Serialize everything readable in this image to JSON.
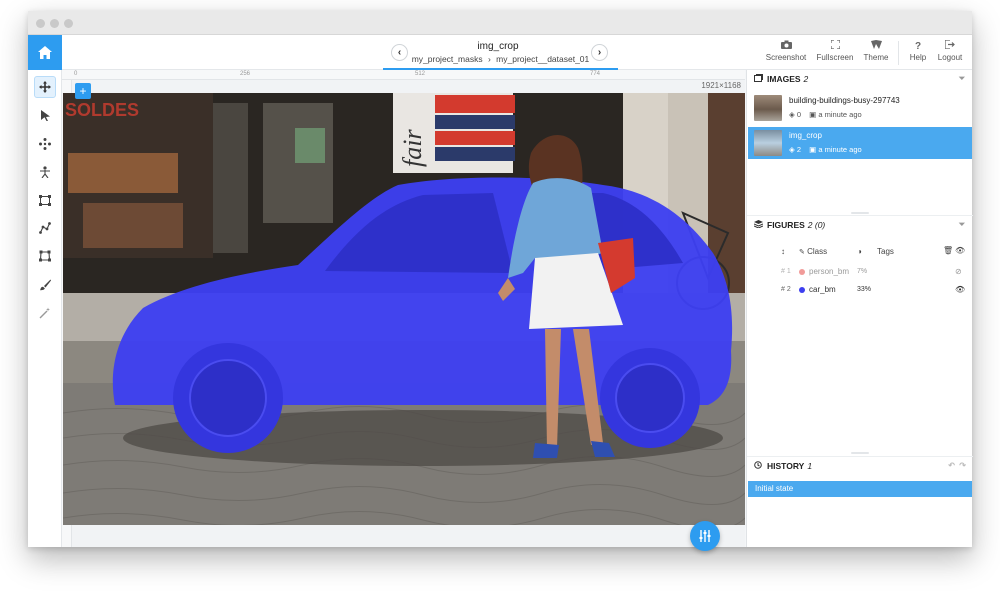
{
  "header": {
    "title": "img_crop",
    "breadcrumb_project": "my_project_masks",
    "breadcrumb_sep": "›",
    "breadcrumb_dataset": "my_project__dataset_01",
    "prev_label": "‹",
    "next_label": "›",
    "actions": [
      {
        "label": "Screenshot",
        "icon": "camera-icon"
      },
      {
        "label": "Fullscreen",
        "icon": "fullscreen-icon"
      },
      {
        "label": "Theme",
        "icon": "theme-icon"
      },
      {
        "label": "Help",
        "icon": "help-icon"
      },
      {
        "label": "Logout",
        "icon": "logout-icon"
      }
    ]
  },
  "toolbar": {
    "tools": [
      "move-tool",
      "pointer-tool",
      "points-tool",
      "keypoint-tool",
      "bbox-tool",
      "polyline-tool",
      "polygon-tool",
      "brush-tool",
      "smart-tool"
    ]
  },
  "canvas": {
    "ruler_ticks": [
      "0",
      "256",
      "512",
      "774"
    ],
    "dimensions": "1921×1168",
    "add_label": "+",
    "store_text": "SOLDES",
    "shop_text": "fair",
    "mask_color": "#3d3ff0"
  },
  "images": {
    "title": "IMAGES",
    "count": "2",
    "items": [
      {
        "name": "building-buildings-busy-297743",
        "figures": "0",
        "time": "a minute ago",
        "selected": false
      },
      {
        "name": "img_crop",
        "figures": "2",
        "time": "a minute ago",
        "selected": true
      }
    ]
  },
  "figures": {
    "title": "FIGURES",
    "count": "2 (0)",
    "col_sort": "↕",
    "col_class": "Class",
    "col_tags": "Tags",
    "items": [
      {
        "num": "# 1",
        "class": "person_bm",
        "pct": "7%",
        "color": "#e53935",
        "visible": false
      },
      {
        "num": "# 2",
        "class": "car_bm",
        "pct": "33%",
        "color": "#3d3ff0",
        "visible": true
      }
    ]
  },
  "history": {
    "title": "HISTORY",
    "count": "1",
    "items": [
      "Initial state"
    ]
  },
  "colors": {
    "accent": "#2d9cf0",
    "selection": "#4aa9ef"
  }
}
